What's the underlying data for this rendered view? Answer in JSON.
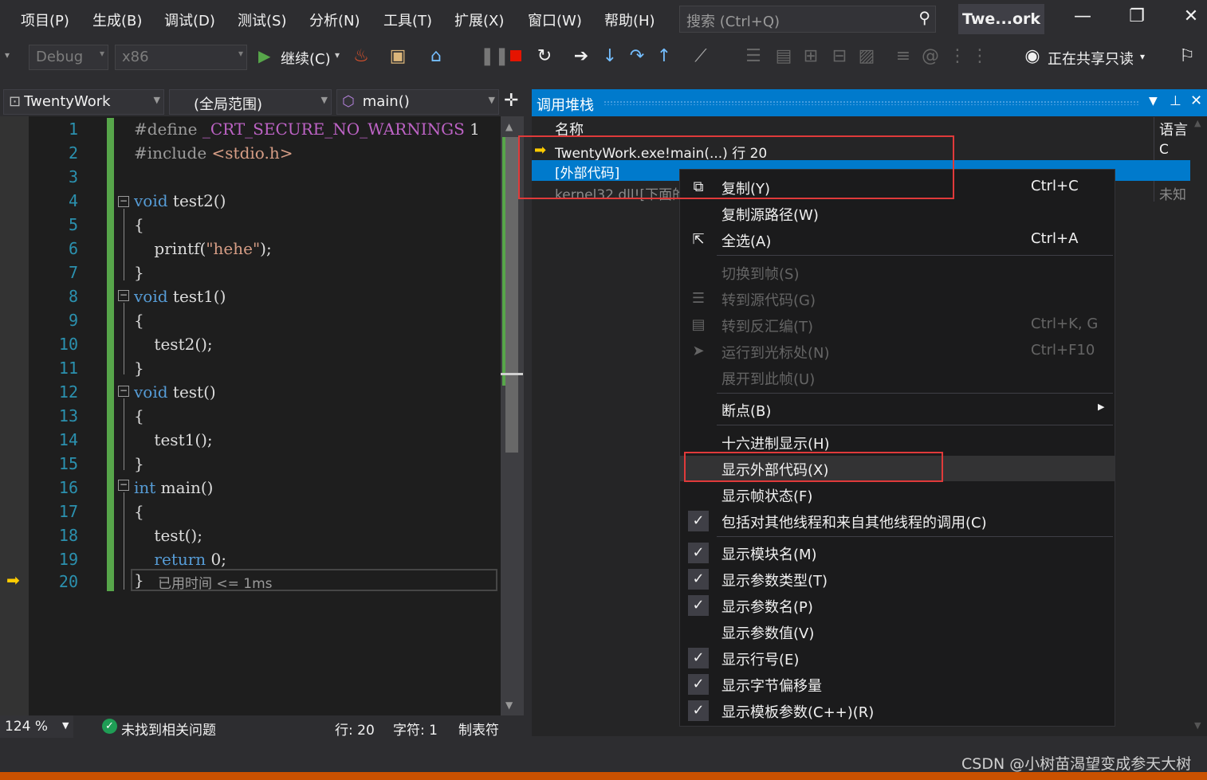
{
  "menu": {
    "items": [
      "项目(P)",
      "生成(B)",
      "调试(D)",
      "测试(S)",
      "分析(N)",
      "工具(T)",
      "扩展(X)",
      "窗口(W)",
      "帮助(H)"
    ],
    "search_placeholder": "搜索 (Ctrl+Q)",
    "solution_title": "Twe...ork"
  },
  "toolbar": {
    "config": "Debug",
    "platform": "x86",
    "continue_label": "继续(C)",
    "share_label": "正在共享只读"
  },
  "editor": {
    "project_dropdown": "TwentyWork",
    "scope_dropdown": "(全局范围)",
    "member_dropdown": "main()",
    "line_numbers": [
      "1",
      "2",
      "3",
      "4",
      "5",
      "6",
      "7",
      "8",
      "9",
      "10",
      "11",
      "12",
      "13",
      "14",
      "15",
      "16",
      "17",
      "18",
      "19",
      "20"
    ],
    "code": {
      "l1a": "#define ",
      "l1b": "_CRT_SECURE_NO_WARNINGS",
      "l1c": " 1",
      "l2a": "#include ",
      "l2b": "<stdio.h>",
      "l4a": "void ",
      "l4b": "test2()",
      "l5": "{",
      "l6a": "    printf(",
      "l6b": "\"hehe\"",
      "l6c": ");",
      "l7": "}",
      "l8a": "void ",
      "l8b": "test1()",
      "l9": "{",
      "l10": "    test2();",
      "l11": "}",
      "l12a": "void ",
      "l12b": "test()",
      "l13": "{",
      "l14": "    test1();",
      "l15": "}",
      "l16a": "int ",
      "l16b": "main()",
      "l17": "{",
      "l18": "    test();",
      "l19a": "    return ",
      "l19b": "0;",
      "l20a": "}",
      "l20b": "已用时间 <= 1ms"
    }
  },
  "status": {
    "zoom": "124 %",
    "issues": "未找到相关问题",
    "line": "行: 20",
    "char": "字符: 1",
    "tab": "制表符"
  },
  "callstack": {
    "title": "调用堆栈",
    "col_name": "名称",
    "col_lang": "语言",
    "rows": [
      {
        "name": "TwentyWork.exe!main(...) 行 20",
        "lang": "C"
      },
      {
        "name": "[外部代码]",
        "lang": ""
      },
      {
        "name": "kernel32.dll![下面的",
        "lang": "未知"
      }
    ]
  },
  "context_menu": {
    "copy": "复制(Y)",
    "copy_sc": "Ctrl+C",
    "copy_path": "复制源路径(W)",
    "select_all": "全选(A)",
    "select_all_sc": "Ctrl+A",
    "switch_frame": "切换到帧(S)",
    "goto_source": "转到源代码(G)",
    "goto_disasm": "转到反汇编(T)",
    "goto_disasm_sc": "Ctrl+K, G",
    "run_to_cursor": "运行到光标处(N)",
    "run_to_cursor_sc": "Ctrl+F10",
    "expand_frame": "展开到此帧(U)",
    "breakpoint": "断点(B)",
    "hex": "十六进制显示(H)",
    "show_external": "显示外部代码(X)",
    "show_frame_status": "显示帧状态(F)",
    "include_threads": "包括对其他线程和来自其他线程的调用(C)",
    "show_module": "显示模块名(M)",
    "show_param_types": "显示参数类型(T)",
    "show_param_names": "显示参数名(P)",
    "show_param_values": "显示参数值(V)",
    "show_line_numbers": "显示行号(E)",
    "show_byte_offset": "显示字节偏移量",
    "show_template_params": "显示模板参数(C++)(R)"
  },
  "watermark": "CSDN @小树苗渴望变成参天大树"
}
